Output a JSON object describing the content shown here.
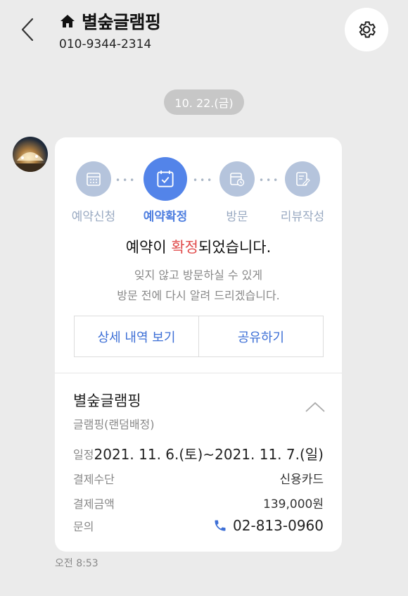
{
  "header": {
    "title": "별숲글램핑",
    "phone": "010-9344-2314"
  },
  "chat": {
    "date": "10. 22.(금)",
    "time": "오전 8:53"
  },
  "card": {
    "steps": [
      {
        "label": "예약신청",
        "active": false
      },
      {
        "label": "예약확정",
        "active": true
      },
      {
        "label": "방문",
        "active": false
      },
      {
        "label": "리뷰작성",
        "active": false
      }
    ],
    "headline_pre": "예약이 ",
    "headline_accent": "확정",
    "headline_post": "되었습니다.",
    "sub1": "잊지 않고 방문하실 수 있게",
    "sub2": "방문 전에 다시 알려 드리겠습니다.",
    "detail_button": "상세 내역 보기",
    "share_button": "공유하기",
    "place_name": "별숲글램핑",
    "place_type": "글램핑(랜덤배정)",
    "info": {
      "schedule_label": "일정",
      "schedule_value": "2021. 11. 6.(토)~2021. 11. 7.(일)",
      "payment_method_label": "결제수단",
      "payment_method_value": "신용카드",
      "payment_amount_label": "결제금액",
      "payment_amount_value": "139,000원",
      "inquiry_label": "문의",
      "inquiry_value": "02-813-0960"
    }
  },
  "colors": {
    "accent_blue": "#5384e9",
    "accent_red": "#e04b4b",
    "inactive_step": "#b5c4dc",
    "background": "#ebebeb"
  }
}
